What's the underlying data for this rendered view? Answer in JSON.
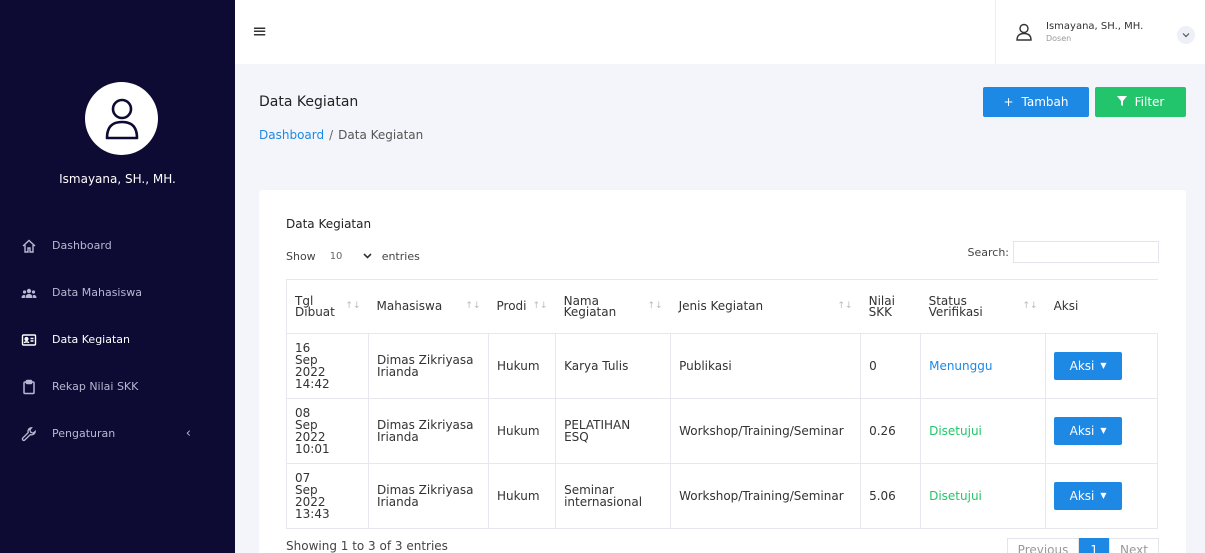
{
  "sidebar": {
    "user_name": "Ismayana, SH., MH.",
    "items": [
      {
        "label": "Dashboard",
        "icon": "home-icon"
      },
      {
        "label": "Data Mahasiswa",
        "icon": "users-icon"
      },
      {
        "label": "Data Kegiatan",
        "icon": "id-card-icon",
        "active": true
      },
      {
        "label": "Rekap Nilai SKK",
        "icon": "clipboard-icon"
      },
      {
        "label": "Pengaturan",
        "icon": "wrench-icon",
        "chevron": "‹"
      }
    ]
  },
  "topbar": {
    "menu_icon": "≡",
    "user_name": "Ismayana, SH., MH.",
    "user_role": "Dosen"
  },
  "page": {
    "title": "Data Kegiatan",
    "breadcrumb": {
      "home": "Dashboard",
      "sep": "/",
      "current": "Data Kegiatan"
    },
    "tambah_label": "Tambah",
    "filter_label": "Filter"
  },
  "card": {
    "title": "Data Kegiatan",
    "show_label": "Show",
    "entries_value": "10",
    "entries_label": "entries",
    "search_label": "Search:",
    "search_value": ""
  },
  "table": {
    "headers": {
      "tgl": "Tgl Dibuat",
      "mahasiswa": "Mahasiswa",
      "prodi": "Prodi",
      "nama": "Nama Kegiatan",
      "jenis": "Jenis Kegiatan",
      "nilai": "Nilai SKK",
      "status": "Status Verifikasi",
      "aksi": "Aksi"
    },
    "rows": [
      {
        "tgl": "16 Sep 2022 14:42",
        "mahasiswa": "Dimas Zikriyasa Irianda",
        "prodi": "Hukum",
        "nama": "Karya Tulis",
        "jenis": "Publikasi",
        "nilai": "0",
        "status": "Menunggu",
        "aksi": "Aksi"
      },
      {
        "tgl": "08 Sep 2022 10:01",
        "mahasiswa": "Dimas Zikriyasa Irianda",
        "prodi": "Hukum",
        "nama": "PELATIHAN ESQ",
        "jenis": "Workshop/Training/Seminar",
        "nilai": "0.26",
        "status": "Disetujui",
        "aksi": "Aksi"
      },
      {
        "tgl": "07 Sep 2022 13:43",
        "mahasiswa": "Dimas Zikriyasa Irianda",
        "prodi": "Hukum",
        "nama": "Seminar internasional",
        "jenis": "Workshop/Training/Seminar",
        "nilai": "5.06",
        "status": "Disetujui",
        "aksi": "Aksi"
      }
    ]
  },
  "footer": {
    "info": "Showing 1 to 3 of 3 entries",
    "prev": "Previous",
    "page": "1",
    "next": "Next"
  },
  "colors": {
    "sidebar_bg": "#0d0a33",
    "primary": "#1e88e5",
    "success": "#22c56b"
  }
}
